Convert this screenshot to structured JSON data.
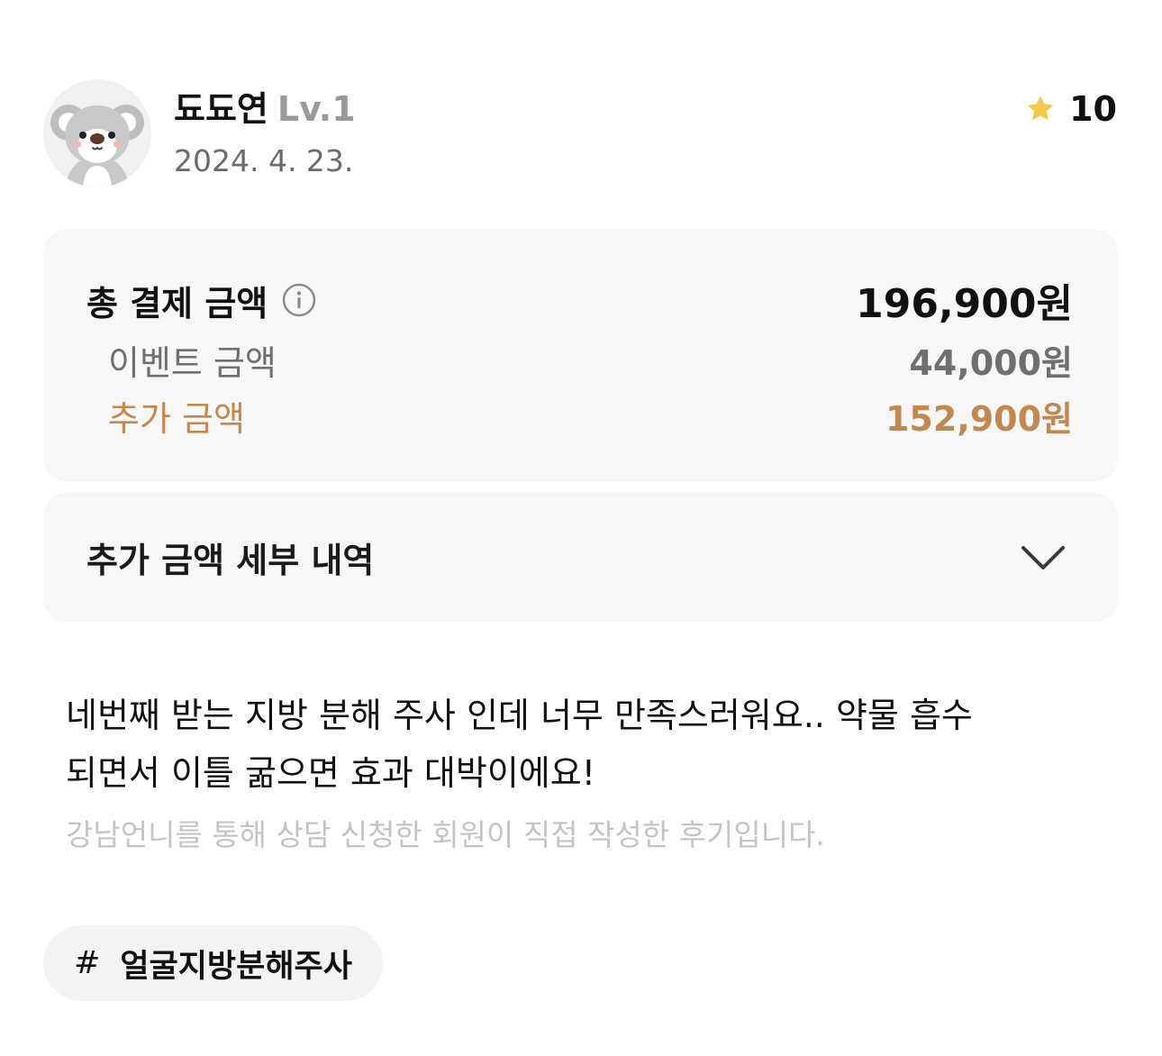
{
  "user": {
    "name": "됴됴연",
    "level": "Lv.1",
    "date": "2024. 4. 23.",
    "avatar_icon": "koala-avatar-icon"
  },
  "rating": {
    "icon": "star-icon",
    "score": "10",
    "star_color": "#F7C948"
  },
  "payment": {
    "total_label": "총 결제 금액",
    "total_value": "196,900원",
    "info_icon": "info-icon",
    "event_label": "이벤트 금액",
    "event_value": "44,000원",
    "extra_label": "추가 금액",
    "extra_value": "152,900원",
    "extra_color": "#C28850"
  },
  "details": {
    "label": "추가 금액 세부 내역",
    "icon": "chevron-down-icon"
  },
  "review": {
    "line1": "네번째 받는 지방 분해 주사 인데 너무 만족스러워요.. 약물 흡수",
    "line2": "되면서 이틀 굶으면 효과 대박이에요!",
    "note": "강남언니를 통해 상담 신청한 회원이 직접 작성한 후기입니다."
  },
  "tags": [
    {
      "symbol": "#",
      "label": "얼굴지방분해주사"
    }
  ]
}
